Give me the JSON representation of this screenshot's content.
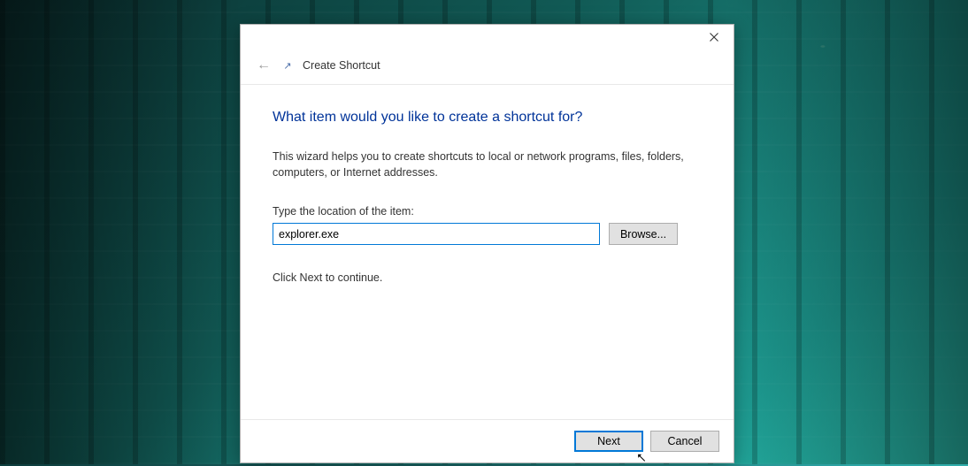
{
  "dialog": {
    "title": "Create Shortcut",
    "heading": "What item would you like to create a shortcut for?",
    "description": "This wizard helps you to create shortcuts to local or network programs, files, folders, computers, or Internet addresses.",
    "field_label": "Type the location of the item:",
    "location_value": "explorer.exe",
    "browse_label": "Browse...",
    "continue_text": "Click Next to continue.",
    "next_label": "Next",
    "cancel_label": "Cancel"
  }
}
